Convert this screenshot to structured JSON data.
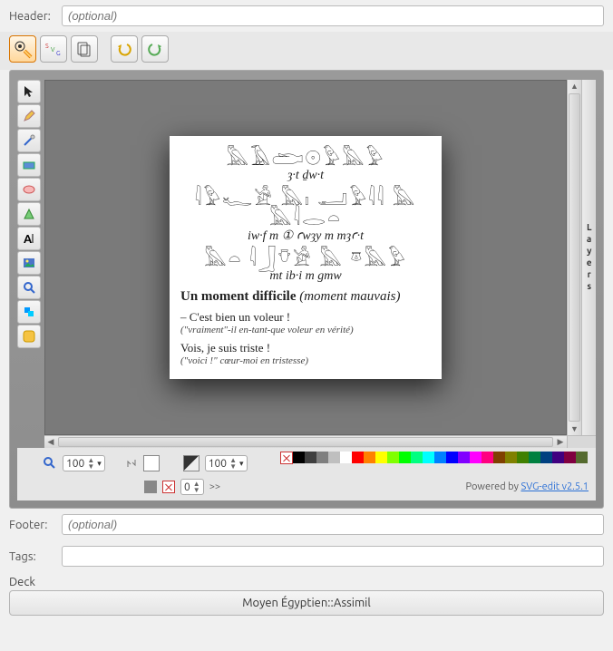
{
  "header": {
    "label": "Header:",
    "placeholder": "(optional)"
  },
  "footer": {
    "label": "Footer:",
    "placeholder": "(optional)"
  },
  "tags": {
    "label": "Tags:",
    "value": ""
  },
  "deck": {
    "label": "Deck",
    "button": "Moyen Égyptien::Assimil"
  },
  "zoom": {
    "value": "100"
  },
  "opacity": {
    "value": "100"
  },
  "stroke_dash": {
    "value": "0"
  },
  "arrow": ">>",
  "layers_label": "Layers",
  "powered": {
    "text": "Powered by ",
    "link": "SVG-edit v2.5.1"
  },
  "document": {
    "h1": "𓅓𓄿𓂧𓇳𓅱𓅓𓅱",
    "t1": "ȝ·t   ḏw·t",
    "h2": "𓇋𓅱𓆑𓀀 𓅓𓏤 𓂝𓅱𓇋𓇋 𓅓 𓅓𓇋𓂋𓏏",
    "t2": "iw·f  m ①   ꜥwȝy        m   mȝꜥ·t",
    "h3": "𓅓𓏏 𓇋𓃀𓄣𓀀 𓅓 𓎼𓅓𓅱",
    "t3": "mt       ib·i   m    gmw",
    "title_bold": "Un moment difficile",
    "title_ital": "(moment mauvais)",
    "l1": "– C'est bien un voleur !",
    "n1": "(\"vraiment\"-il en-tant-que voleur en vérité)",
    "l2": "Vois, je suis triste !",
    "n2": "(\"voici !\" cœur-moi en tristesse)"
  },
  "palette": [
    "#000000",
    "#3f3f3f",
    "#7f7f7f",
    "#bfbfbf",
    "#ffffff",
    "#ff0000",
    "#ff8000",
    "#ffff00",
    "#80ff00",
    "#00ff00",
    "#00ff80",
    "#00ffff",
    "#0080ff",
    "#0000ff",
    "#8000ff",
    "#ff00ff",
    "#ff0080",
    "#804000",
    "#808000",
    "#408000",
    "#008040",
    "#004080",
    "#400080",
    "#800040",
    "#556b2f"
  ]
}
